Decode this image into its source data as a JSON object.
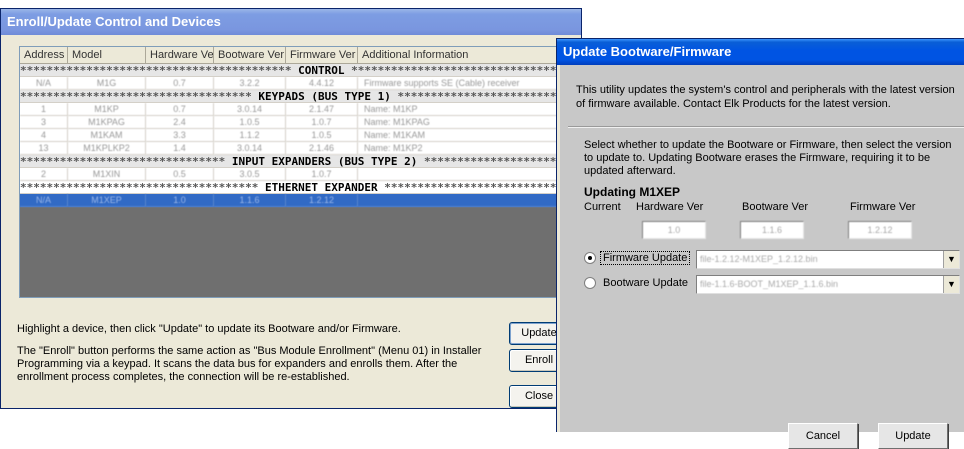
{
  "enroll_window": {
    "title": "Enroll/Update Control and Devices",
    "columns": [
      "Address",
      "Model",
      "Hardware Ver",
      "Bootware Ver",
      "Firmware Ver",
      "Additional Information"
    ],
    "sections": [
      {
        "label": "CONTROL",
        "rows": [
          [
            "N/A",
            "M1G",
            "0.7",
            "3.2.2",
            "4.4.12",
            "Firmware supports SE (Cable) receiver"
          ]
        ]
      },
      {
        "label": "KEYPADS (BUS TYPE 1)",
        "rows": [
          [
            "1",
            "M1KP",
            "0.7",
            "3.0.14",
            "2.1.47",
            "Name: M1KP"
          ],
          [
            "3",
            "M1KPAG",
            "2.4",
            "1.0.5",
            "1.0.7",
            "Name: M1KPAG"
          ],
          [
            "4",
            "M1KAM",
            "3.3",
            "1.1.2",
            "1.0.5",
            "Name: M1KAM"
          ],
          [
            "13",
            "M1KPLKP2",
            "1.4",
            "3.0.14",
            "2.1.46",
            "Name: M1KP2"
          ]
        ]
      },
      {
        "label": "INPUT EXPANDERS (BUS TYPE 2)",
        "rows": [
          [
            "2",
            "M1XIN",
            "0.5",
            "3.0.5",
            "1.0.7",
            ""
          ]
        ]
      },
      {
        "label": "ETHERNET EXPANDER",
        "rows": [
          [
            "N/A",
            "M1XEP",
            "1.0",
            "1.1.6",
            "1.2.12",
            ""
          ]
        ],
        "selected": true
      }
    ],
    "hint": "Highlight a device, then click \"Update\" to update its Bootware and/or Firmware.",
    "enroll_description": "The \"Enroll\" button performs the same action as \"Bus Module Enrollment\" (Menu 01) in Installer Programming via a keypad. It scans the data bus for expanders and enrolls them. After the enrollment process completes, the connection will be re-established.",
    "buttons": {
      "update": "Update",
      "enroll": "Enroll",
      "close": "Close"
    }
  },
  "boot_window": {
    "title": "Update Bootware/Firmware",
    "utility_text": "This utility updates the system's control and peripherals with the latest version of firmware available.  Contact Elk Products for the latest version.",
    "select_text": "Select whether to update the Bootware or Firmware, then select the version to update to.  Updating Bootware erases the Firmware, requiring it to be updated afterward.",
    "updating_label": "Updating M1XEP",
    "current_label": "Current",
    "hardware_label": "Hardware Ver",
    "bootware_label": "Bootware Ver",
    "firmware_label": "Firmware Ver",
    "hardware_value": "1.0",
    "bootware_value": "1.1.6",
    "firmware_value": "1.2.12",
    "firmware_option": "Firmware Update",
    "bootware_option": "Bootware Update",
    "firmware_file": "file-1.2.12-M1XEP_1.2.12.bin",
    "bootware_file": "file-1.1.6-BOOT_M1XEP_1.1.6.bin",
    "selected_option": "firmware",
    "cancel": "Cancel",
    "update": "Update"
  }
}
